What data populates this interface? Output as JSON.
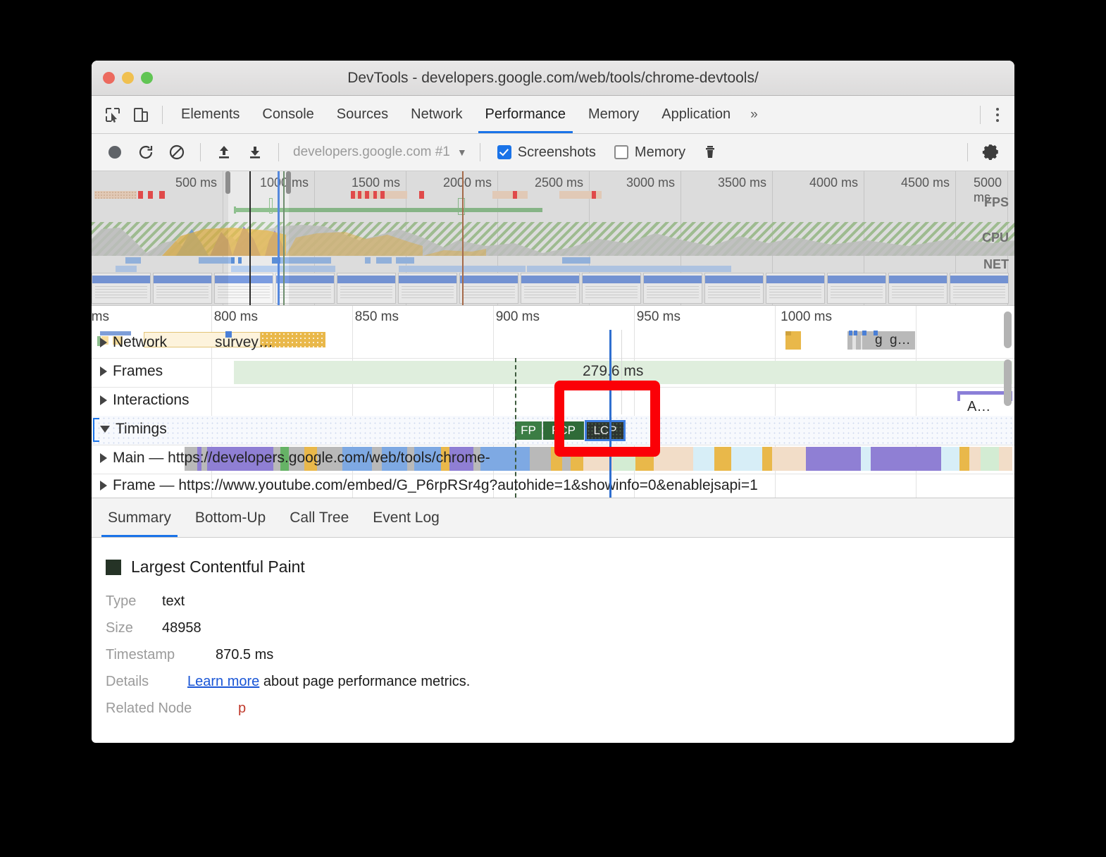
{
  "window": {
    "title": "DevTools - developers.google.com/web/tools/chrome-devtools/",
    "controls": {
      "close": "close",
      "minimize": "minimize",
      "maximize": "maximize"
    }
  },
  "tabstrip": {
    "inspect_icon": "inspect-element-icon",
    "device_icon": "device-toolbar-icon",
    "tabs": [
      {
        "label": "Elements",
        "active": false
      },
      {
        "label": "Console",
        "active": false
      },
      {
        "label": "Sources",
        "active": false
      },
      {
        "label": "Network",
        "active": false
      },
      {
        "label": "Performance",
        "active": true
      },
      {
        "label": "Memory",
        "active": false
      },
      {
        "label": "Application",
        "active": false
      }
    ],
    "more_tabs_label": "»",
    "menu_icon": "kebab-menu-icon"
  },
  "toolbar": {
    "record_icon": "record-circle-icon",
    "reload_icon": "reload-and-record-icon",
    "clear_icon": "clear-recording-icon",
    "load_icon": "load-profile-icon",
    "save_icon": "save-profile-icon",
    "profile_select_value": "developers.google.com #1",
    "profile_select_caret": "▼",
    "screenshots_label": "Screenshots",
    "screenshots_checked": true,
    "memory_label": "Memory",
    "memory_checked": false,
    "trash_icon": "delete-icon",
    "settings_icon": "gear-icon"
  },
  "overview": {
    "ticks": [
      "500 ms",
      "1000 ms",
      "1500 ms",
      "2000 ms",
      "2500 ms",
      "3000 ms",
      "3500 ms",
      "4000 ms",
      "4500 ms",
      "5000 ms"
    ],
    "row_labels": [
      "FPS",
      "CPU",
      "NET"
    ]
  },
  "flamechart": {
    "ticks": [
      "ms",
      "800 ms",
      "850 ms",
      "900 ms",
      "950 ms",
      "1000 ms"
    ],
    "tracks": [
      {
        "name": "Network",
        "label": "Network",
        "overlay_text": "survey…",
        "expanded": false,
        "selected": false
      },
      {
        "name": "Frames",
        "label": "Frames",
        "expanded": false,
        "selected": false,
        "duration_label": "279.6 ms"
      },
      {
        "name": "Interactions",
        "label": "Interactions",
        "expanded": false,
        "selected": false,
        "right_event": "A…"
      },
      {
        "name": "Timings",
        "label": "Timings",
        "expanded": true,
        "selected": true
      },
      {
        "name": "Main",
        "label": "Main — https://developers.google.com/web/tools/chrome-",
        "expanded": false,
        "selected": false
      },
      {
        "name": "Frame",
        "label": "Frame — https://www.youtube.com/embed/G_P6rpRSr4g?autohide=1&showinfo=0&enablejsapi=1",
        "expanded": false,
        "selected": false
      }
    ],
    "timing_markers": [
      {
        "id": "FP",
        "label": "FP"
      },
      {
        "id": "FCP",
        "label": "FCP"
      },
      {
        "id": "LCP",
        "label": "LCP",
        "selected": true
      }
    ],
    "network_right_labels": [
      "g",
      "g…"
    ]
  },
  "bottom_tabs": [
    {
      "label": "Summary",
      "active": true
    },
    {
      "label": "Bottom-Up",
      "active": false
    },
    {
      "label": "Call Tree",
      "active": false
    },
    {
      "label": "Event Log",
      "active": false
    }
  ],
  "details": {
    "swatch_color": "#253326",
    "title": "Largest Contentful Paint",
    "rows": [
      {
        "key": "Type",
        "value": "text"
      },
      {
        "key": "Size",
        "value": "48958"
      },
      {
        "key": "Timestamp",
        "value": "870.5 ms"
      }
    ],
    "details_key": "Details",
    "details_link": "Learn more",
    "details_rest": " about page performance metrics.",
    "related_key": "Related Node",
    "related_value": "p"
  },
  "annotation": {
    "color": "#fb0007",
    "target": "LCP marker"
  },
  "colors": {
    "accent": "#1a73e8",
    "annotation": "#fb0007",
    "fp": "#3b7d44",
    "fcp": "#2f6b38",
    "lcp": "#253326",
    "frames_band": "#dfeedd",
    "selection_blue": "#3f7fe0"
  }
}
